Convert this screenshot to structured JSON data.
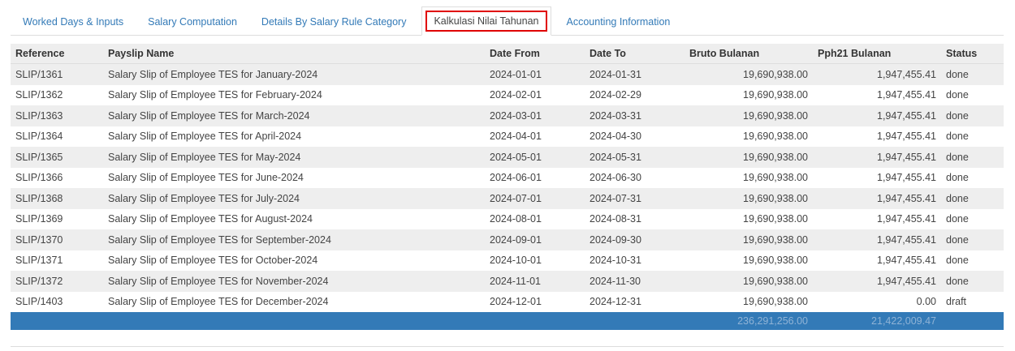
{
  "tabs": [
    {
      "label": "Worked Days & Inputs"
    },
    {
      "label": "Salary Computation"
    },
    {
      "label": "Details By Salary Rule Category"
    },
    {
      "label": "Kalkulasi Nilai Tahunan",
      "active": true
    },
    {
      "label": "Accounting Information"
    }
  ],
  "table": {
    "headers": {
      "reference": "Reference",
      "payslip_name": "Payslip Name",
      "date_from": "Date From",
      "date_to": "Date To",
      "bruto": "Bruto Bulanan",
      "pph21": "Pph21 Bulanan",
      "status": "Status"
    },
    "rows": [
      {
        "reference": "SLIP/1361",
        "payslip_name": "Salary Slip of Employee TES for January-2024",
        "date_from": "2024-01-01",
        "date_to": "2024-01-31",
        "bruto": "19,690,938.00",
        "pph21": "1,947,455.41",
        "status": "done"
      },
      {
        "reference": "SLIP/1362",
        "payslip_name": "Salary Slip of Employee TES for February-2024",
        "date_from": "2024-02-01",
        "date_to": "2024-02-29",
        "bruto": "19,690,938.00",
        "pph21": "1,947,455.41",
        "status": "done"
      },
      {
        "reference": "SLIP/1363",
        "payslip_name": "Salary Slip of Employee TES for March-2024",
        "date_from": "2024-03-01",
        "date_to": "2024-03-31",
        "bruto": "19,690,938.00",
        "pph21": "1,947,455.41",
        "status": "done"
      },
      {
        "reference": "SLIP/1364",
        "payslip_name": "Salary Slip of Employee TES for April-2024",
        "date_from": "2024-04-01",
        "date_to": "2024-04-30",
        "bruto": "19,690,938.00",
        "pph21": "1,947,455.41",
        "status": "done"
      },
      {
        "reference": "SLIP/1365",
        "payslip_name": "Salary Slip of Employee TES for May-2024",
        "date_from": "2024-05-01",
        "date_to": "2024-05-31",
        "bruto": "19,690,938.00",
        "pph21": "1,947,455.41",
        "status": "done"
      },
      {
        "reference": "SLIP/1366",
        "payslip_name": "Salary Slip of Employee TES for June-2024",
        "date_from": "2024-06-01",
        "date_to": "2024-06-30",
        "bruto": "19,690,938.00",
        "pph21": "1,947,455.41",
        "status": "done"
      },
      {
        "reference": "SLIP/1368",
        "payslip_name": "Salary Slip of Employee TES for July-2024",
        "date_from": "2024-07-01",
        "date_to": "2024-07-31",
        "bruto": "19,690,938.00",
        "pph21": "1,947,455.41",
        "status": "done"
      },
      {
        "reference": "SLIP/1369",
        "payslip_name": "Salary Slip of Employee TES for August-2024",
        "date_from": "2024-08-01",
        "date_to": "2024-08-31",
        "bruto": "19,690,938.00",
        "pph21": "1,947,455.41",
        "status": "done"
      },
      {
        "reference": "SLIP/1370",
        "payslip_name": "Salary Slip of Employee TES for September-2024",
        "date_from": "2024-09-01",
        "date_to": "2024-09-30",
        "bruto": "19,690,938.00",
        "pph21": "1,947,455.41",
        "status": "done"
      },
      {
        "reference": "SLIP/1371",
        "payslip_name": "Salary Slip of Employee TES for October-2024",
        "date_from": "2024-10-01",
        "date_to": "2024-10-31",
        "bruto": "19,690,938.00",
        "pph21": "1,947,455.41",
        "status": "done"
      },
      {
        "reference": "SLIP/1372",
        "payslip_name": "Salary Slip of Employee TES for November-2024",
        "date_from": "2024-11-01",
        "date_to": "2024-11-30",
        "bruto": "19,690,938.00",
        "pph21": "1,947,455.41",
        "status": "done"
      },
      {
        "reference": "SLIP/1403",
        "payslip_name": "Salary Slip of Employee TES for December-2024",
        "date_from": "2024-12-01",
        "date_to": "2024-12-31",
        "bruto": "19,690,938.00",
        "pph21": "0.00",
        "status": "draft"
      }
    ],
    "totals": {
      "bruto": "236,291,256.00",
      "pph21": "21,422,009.47"
    }
  },
  "colors": {
    "tab_link": "#337ab7",
    "active_highlight": "#e00000",
    "footer_bg": "#337ab7",
    "row_stripe": "#eeeeee"
  }
}
